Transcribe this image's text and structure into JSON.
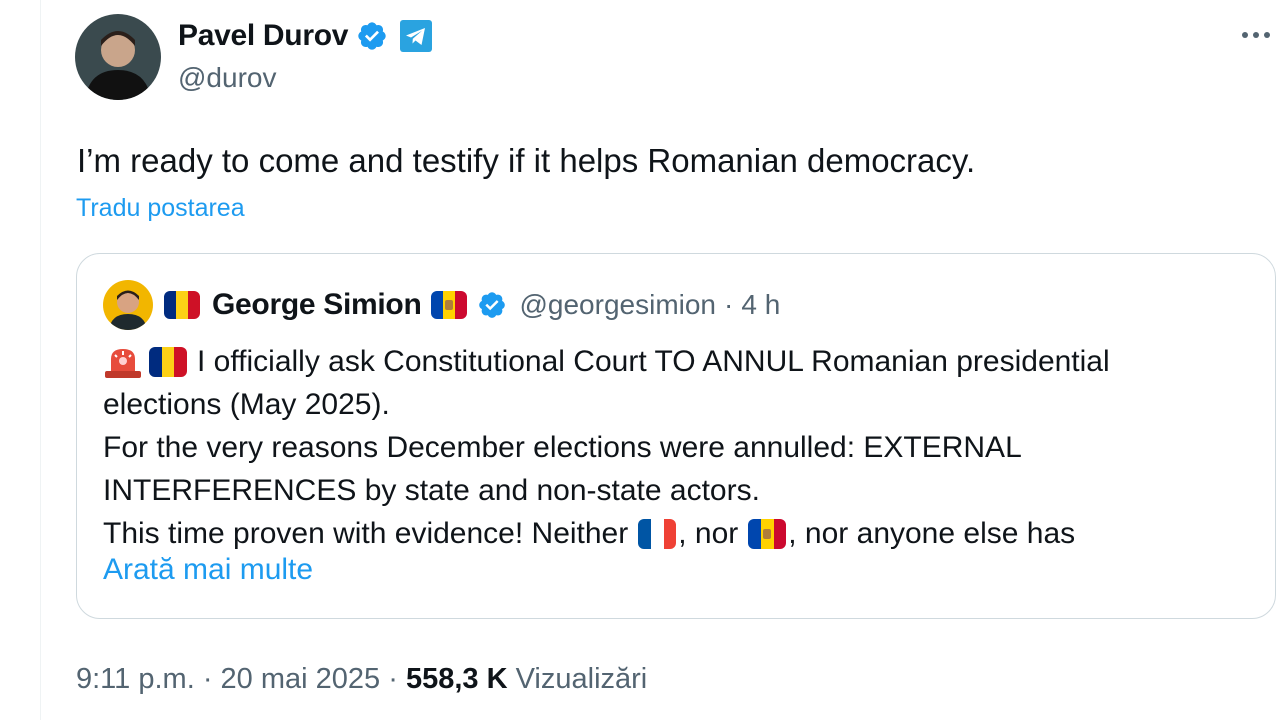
{
  "author": {
    "name": "Pavel Durov",
    "handle": "@durov"
  },
  "tweet": {
    "text": "I’m ready to come and testify if it helps Romanian democracy.",
    "translate_label": "Tradu postarea"
  },
  "quote": {
    "name": "George Simion",
    "handle": "@georgesimion",
    "sep": "·",
    "time": "4 h",
    "line1": "I officially ask Constitutional Court TO ANNUL Romanian presidential",
    "line2": "elections (May 2025).",
    "line3": "For the very reasons December elections were annulled: EXTERNAL",
    "line4": "INTERFERENCES by state and non-state actors.",
    "line5_a": "This time proven with evidence! Neither",
    "line5_b": ", nor",
    "line5_c": ", nor anyone else has",
    "show_more": "Arată mai multe"
  },
  "footer": {
    "time": "9:11 p.m.",
    "sep1": "·",
    "date": "20 mai 2025",
    "sep2": "·",
    "views_count": "558,3 K",
    "views_label": "Vizualizări"
  },
  "icons": {
    "verified": "verified-badge-icon",
    "telegram": "telegram-icon",
    "more": "more-options-icon",
    "siren": "siren-emoji-icon"
  },
  "colors": {
    "accent": "#1d9bf0",
    "muted": "#536471",
    "text": "#0f1419",
    "border": "#cfd9de"
  }
}
